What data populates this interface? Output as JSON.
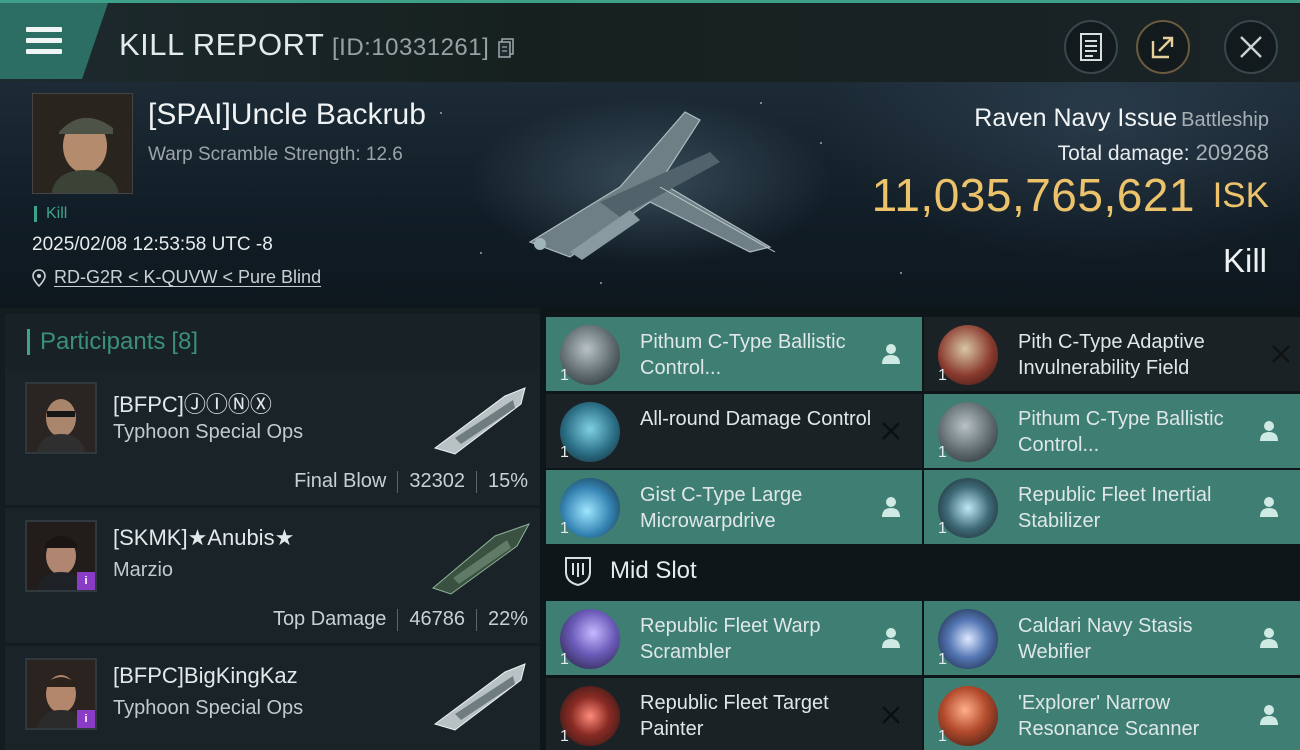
{
  "header": {
    "title": "KILL REPORT",
    "id_text": "[ID:10331261]",
    "menu_icon": "hamburger-menu-icon",
    "actions": [
      {
        "icon": "clipboard-icon"
      },
      {
        "icon": "share-icon"
      },
      {
        "icon": "close-icon"
      }
    ]
  },
  "victim": {
    "name": "[SPAI]Uncle Backrub",
    "warp_scramble": "Warp Scramble Strength: 12.6",
    "tag": "Kill",
    "datetime": "2025/02/08 12:53:58 UTC -8",
    "location": "RD-G2R < K-QUVW < Pure Blind",
    "ship_name": "Raven Navy Issue",
    "ship_class": "Battleship",
    "total_damage_label": "Total damage:",
    "total_damage": "209268",
    "isk_value": "11,035,765,621",
    "isk_unit": "ISK",
    "result": "Kill"
  },
  "participants": {
    "label": "Participants",
    "count": "[8]",
    "rows": [
      {
        "name": "[BFPC]ⒿⒾⓃⓍ",
        "ship": "Typhoon Special Ops",
        "role": "Final Blow",
        "damage": "32302",
        "percent": "15%",
        "badge": ""
      },
      {
        "name": "[SKMK]★Anubis★",
        "ship": "Marzio",
        "role": "Top Damage",
        "damage": "46786",
        "percent": "22%",
        "badge": "i"
      },
      {
        "name": "[BFPC]BigKingKaz",
        "ship": "Typhoon Special Ops",
        "role": "",
        "damage": "",
        "percent": "",
        "badge": "i"
      }
    ]
  },
  "fitting": {
    "mid_slot_label": "Mid Slot",
    "low_modules": [
      {
        "name": "Pithum C-Type Ballistic Control...",
        "qty": "1",
        "state": "dropped"
      },
      {
        "name": "Pith C-Type Adaptive Invulnerability Field",
        "qty": "1",
        "state": "destroyed"
      },
      {
        "name": "All-round Damage Control",
        "qty": "1",
        "state": "destroyed"
      },
      {
        "name": "Pithum C-Type Ballistic Control...",
        "qty": "1",
        "state": "dropped"
      },
      {
        "name": "Gist C-Type Large Microwarpdrive",
        "qty": "1",
        "state": "dropped"
      },
      {
        "name": "Republic Fleet Inertial Stabilizer",
        "qty": "1",
        "state": "dropped"
      }
    ],
    "mid_modules": [
      {
        "name": "Republic Fleet Warp Scrambler",
        "qty": "1",
        "state": "dropped"
      },
      {
        "name": "Caldari Navy Stasis Webifier",
        "qty": "1",
        "state": "dropped"
      },
      {
        "name": "Republic Fleet Target Painter",
        "qty": "1",
        "state": "destroyed"
      },
      {
        "name": "'Explorer' Narrow Resonance Scanner",
        "qty": "1",
        "state": "dropped"
      }
    ]
  },
  "colors": {
    "accent": "#3ea38c",
    "dropped_bg": "#3e7e73",
    "destroyed_bg": "#1b2225",
    "isk": "#ecc36a",
    "badge": "#8b3cc6"
  }
}
